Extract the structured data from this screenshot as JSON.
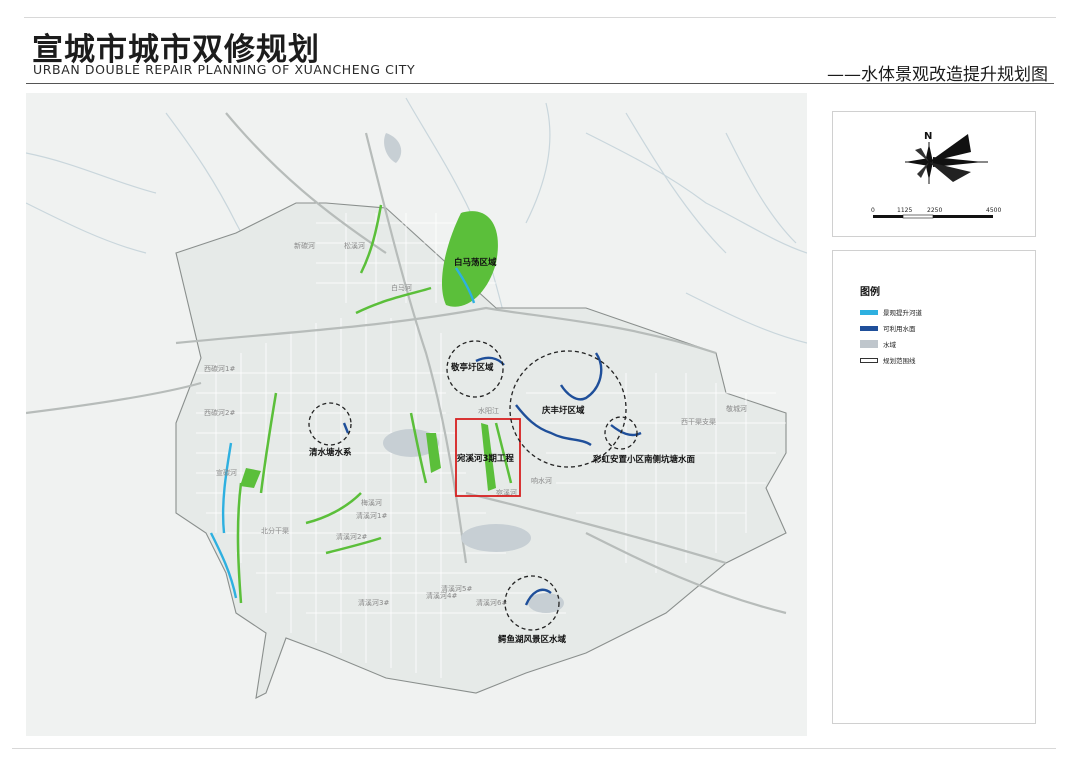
{
  "header": {
    "title_cn": "宣城市城市双修规划",
    "title_en": "URBAN DOUBLE REPAIR PLANNING OF XUANCHENG CITY",
    "subtitle": "——水体景观改造提升规划图"
  },
  "map": {
    "areas": {
      "baima": "白马荡区域",
      "jingting": "敬亭圩区域",
      "qingfeng": "庆丰圩区域",
      "qingshui": "清水塘水系",
      "wanxi": "宛溪河3期工程",
      "caihong": "彩虹安置小区南侧坑塘水面",
      "eyu": "鳄鱼湖风景区水域"
    },
    "river_labels": [
      "西碳河1#",
      "西碳河2#",
      "宣碳河",
      "北分干渠",
      "清溪河1#",
      "清溪河2#",
      "清溪河3#",
      "清溪河4#",
      "清溪河5#",
      "清溪河6#",
      "水阳江",
      "梅溪河",
      "白马河",
      "松溪河",
      "响水河",
      "宛溪河",
      "西干渠支渠",
      "敬城河",
      "新碳河"
    ]
  },
  "compass": {
    "north": "N",
    "scale_labels": [
      "0",
      "1125",
      "2250",
      "4500"
    ]
  },
  "legend": {
    "title": "图例",
    "items": [
      {
        "label": "景观提升河道",
        "color": "#2eb0e0"
      },
      {
        "label": "可利用水面",
        "color": "#1f4f9a"
      },
      {
        "label": "水域",
        "color": "#bfc6cc"
      },
      {
        "label": "规划范围线",
        "color": "#333333"
      }
    ]
  },
  "colors": {
    "landscape_river": "#2eb0e0",
    "usable_water": "#1f4f9a",
    "green": "#5bbf3a",
    "highlight_box": "#d62020"
  }
}
